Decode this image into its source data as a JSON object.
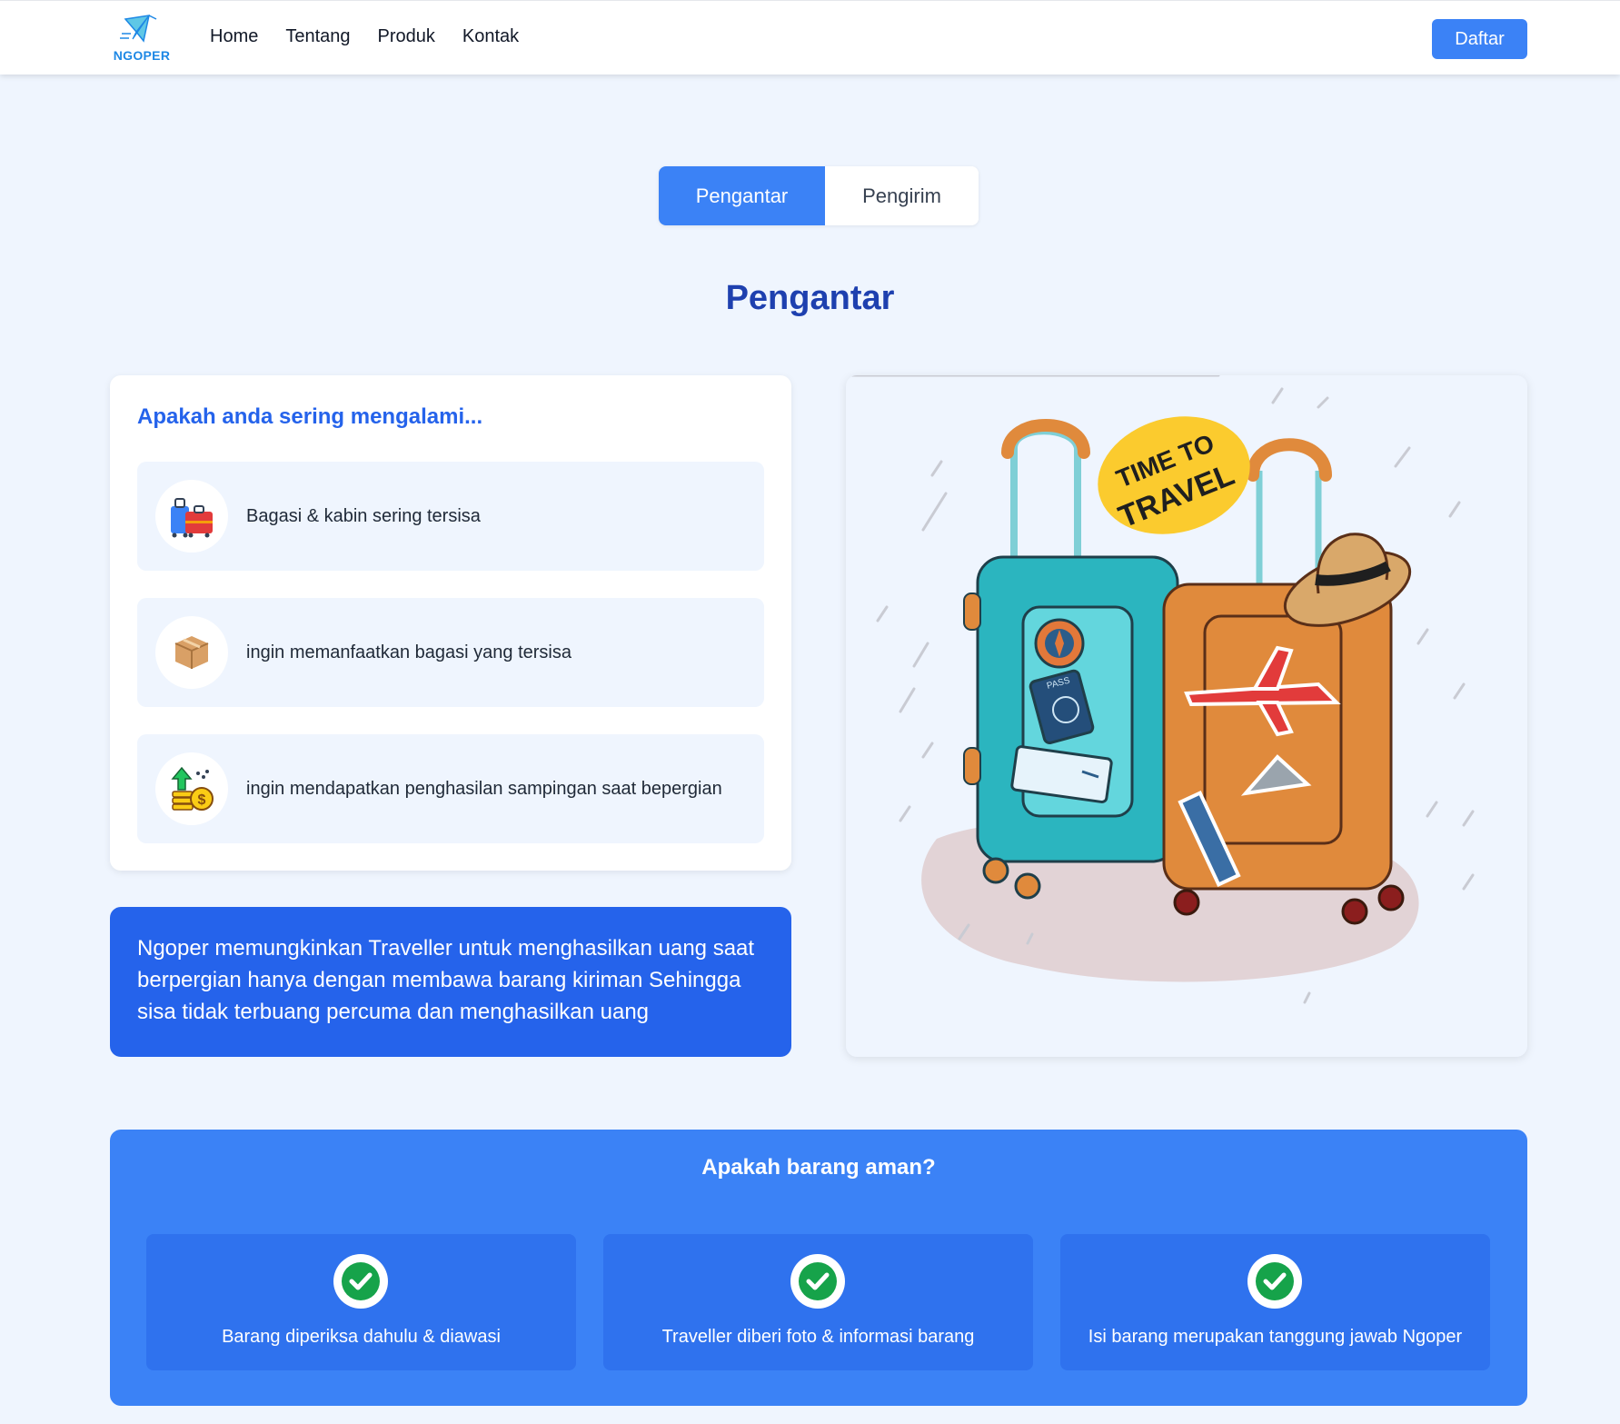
{
  "brand": {
    "name": "NGOPER",
    "color": "#1e88e5"
  },
  "nav": {
    "links": [
      "Home",
      "Tentang",
      "Produk",
      "Kontak"
    ],
    "cta": "Daftar"
  },
  "tabs": [
    {
      "label": "Pengantar",
      "active": true
    },
    {
      "label": "Pengirim",
      "active": false
    }
  ],
  "section": {
    "title": "Pengantar"
  },
  "problems": {
    "title": "Apakah anda sering mengalami...",
    "items": [
      {
        "icon": "luggage-icon",
        "text": "Bagasi & kabin sering tersisa"
      },
      {
        "icon": "box-icon",
        "text": "ingin memanfaatkan bagasi yang tersisa"
      },
      {
        "icon": "money-growth-icon",
        "text": "ingin mendapatkan penghasilan sampingan saat bepergian"
      }
    ]
  },
  "info": {
    "text": "Ngoper memungkinkan Traveller untuk menghasilkan uang saat berpergian hanya dengan membawa barang kiriman Sehingga sisa tidak terbuang percuma dan menghasilkan uang"
  },
  "illustration": {
    "sticker": [
      "TIME TO",
      "TRAVEL"
    ],
    "pass_label": "PASS"
  },
  "safety": {
    "title": "Apakah barang aman?",
    "items": [
      {
        "icon": "check-icon",
        "text": "Barang diperiksa dahulu & diawasi"
      },
      {
        "icon": "check-icon",
        "text": "Traveller diberi foto & informasi barang"
      },
      {
        "icon": "check-icon",
        "text": "Isi barang merupakan tanggung jawab Ngoper"
      }
    ]
  },
  "colors": {
    "primary": "#3b82f6",
    "primary_dark": "#2563eb",
    "heading": "#1e40af",
    "background": "#eff5fe",
    "check": "#16a34a"
  }
}
